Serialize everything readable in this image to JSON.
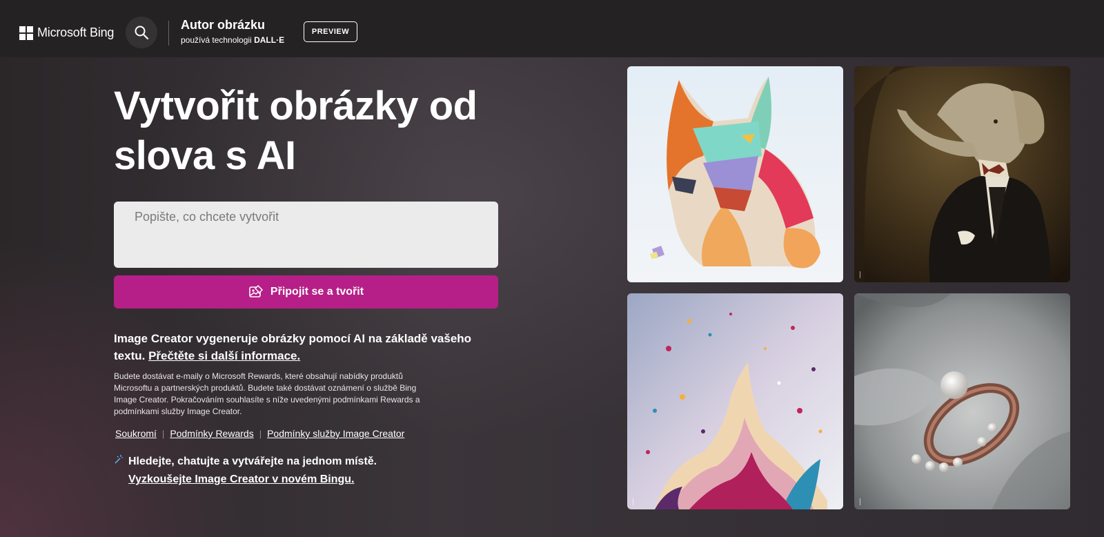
{
  "header": {
    "brand": "Microsoft Bing",
    "search_icon": "search-icon",
    "app_title": "Autor obrázku",
    "app_sub_prefix": "používá technologii",
    "app_sub_tech": "DALL·E",
    "preview_label": "PREVIEW"
  },
  "hero": {
    "headline_line1": "Vytvořit obrázky od",
    "headline_line2": "slova s AI",
    "prompt_placeholder": "Popište, co chcete vytvořit",
    "create_button": "Připojit se a tvořit",
    "create_icon": "image-create-icon",
    "accent_color": "#b61f87"
  },
  "info": {
    "main_text": "Image Creator vygeneruje obrázky pomocí AI na základě vašeho textu.",
    "learn_more": "Přečtěte si další informace.",
    "legal": "Budete dostávat e-maily o Microsoft Rewards, které obsahují nabídky produktů Microsoftu a partnerských produktů. Budete také dostávat oznámení o službě Bing Image Creator. Pokračováním souhlasíte s níže uvedenými podmínkami Rewards a podmínkami služby Image Creator."
  },
  "links": [
    "Soukromí",
    "Podmínky Rewards",
    "Podmínky služby Image Creator"
  ],
  "promo": {
    "line1": "Hledejte, chatujte a vytvářejte na jednom místě.",
    "link": "Vyzkoušejte Image Creator v novém Bingu."
  },
  "gallery": [
    {
      "subject": "paper-art-fox"
    },
    {
      "subject": "elephant-in-suit"
    },
    {
      "subject": "paint-splash"
    },
    {
      "subject": "pearl-ring"
    }
  ]
}
